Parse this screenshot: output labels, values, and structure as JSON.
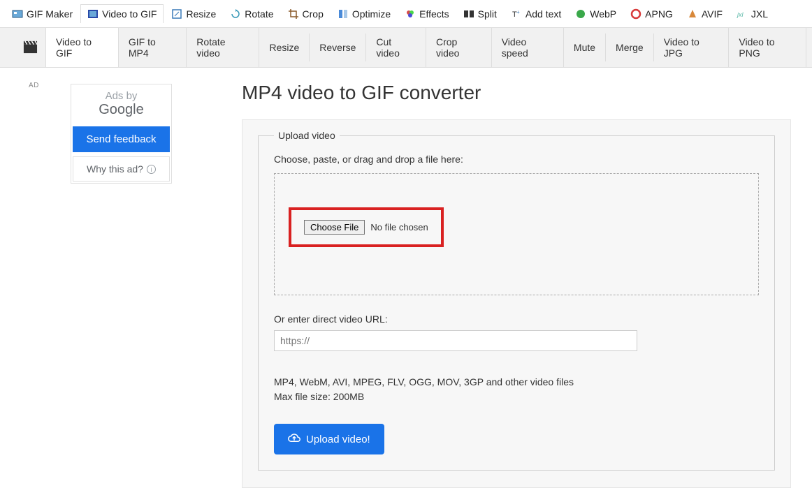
{
  "topnav": [
    {
      "label": "GIF Maker",
      "icon": "gif-maker-icon"
    },
    {
      "label": "Video to GIF",
      "icon": "video-to-gif-icon",
      "active": true
    },
    {
      "label": "Resize",
      "icon": "resize-icon"
    },
    {
      "label": "Rotate",
      "icon": "rotate-icon"
    },
    {
      "label": "Crop",
      "icon": "crop-icon"
    },
    {
      "label": "Optimize",
      "icon": "optimize-icon"
    },
    {
      "label": "Effects",
      "icon": "effects-icon"
    },
    {
      "label": "Split",
      "icon": "split-icon"
    },
    {
      "label": "Add text",
      "icon": "add-text-icon"
    },
    {
      "label": "WebP",
      "icon": "webp-icon"
    },
    {
      "label": "APNG",
      "icon": "apng-icon"
    },
    {
      "label": "AVIF",
      "icon": "avif-icon"
    },
    {
      "label": "JXL",
      "icon": "jxl-icon"
    }
  ],
  "subnav": [
    {
      "label": "Video to GIF",
      "active": true
    },
    {
      "label": "GIF to MP4"
    },
    {
      "label": "Rotate video"
    },
    {
      "label": "Resize"
    },
    {
      "label": "Reverse"
    },
    {
      "label": "Cut video"
    },
    {
      "label": "Crop video"
    },
    {
      "label": "Video speed"
    },
    {
      "label": "Mute"
    },
    {
      "label": "Merge"
    },
    {
      "label": "Video to JPG"
    },
    {
      "label": "Video to PNG"
    }
  ],
  "ad": {
    "badge": "AD",
    "title": "Ads by",
    "logo": "Google",
    "feedback": "Send feedback",
    "why": "Why this ad?"
  },
  "page": {
    "title": "MP4 video to GIF converter",
    "legend": "Upload video",
    "instruction": "Choose, paste, or drag and drop a file here:",
    "choose_btn": "Choose File",
    "no_file": "No file chosen",
    "or_label": "Or enter direct video URL:",
    "url_placeholder": "https://",
    "formats": "MP4, WebM, AVI, MPEG, FLV, OGG, MOV, 3GP and other video files",
    "maxsize": "Max file size: 200MB",
    "upload_btn": "Upload video!"
  }
}
